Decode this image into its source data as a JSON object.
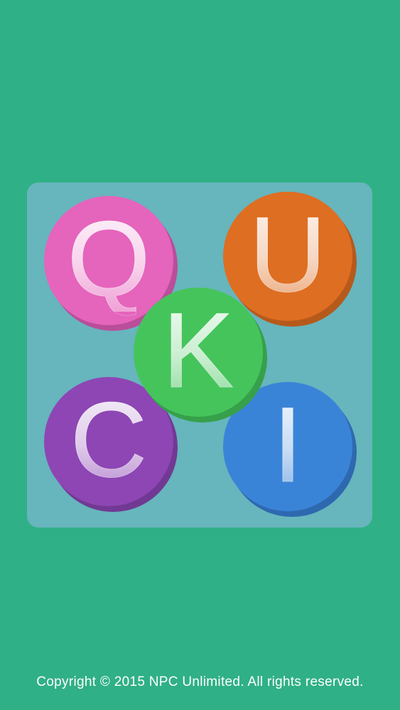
{
  "colors": {
    "background": "#30B086",
    "bubble_q": "#E564BC",
    "bubble_q_shadow": "#B94E9A",
    "bubble_u": "#DE6E22",
    "bubble_u_shadow": "#B65A1C",
    "bubble_k": "#45C45C",
    "bubble_k_shadow": "#36A04A",
    "bubble_c": "#8D46B4",
    "bubble_c_shadow": "#713993",
    "bubble_i": "#3A84D8",
    "bubble_i_shadow": "#2E69B0"
  },
  "logo": {
    "letters": {
      "q": "Q",
      "u": "U",
      "k": "K",
      "c": "C",
      "i": "I"
    }
  },
  "footer": {
    "copyright": "Copyright © 2015 NPC Unlimited. All rights reserved."
  }
}
